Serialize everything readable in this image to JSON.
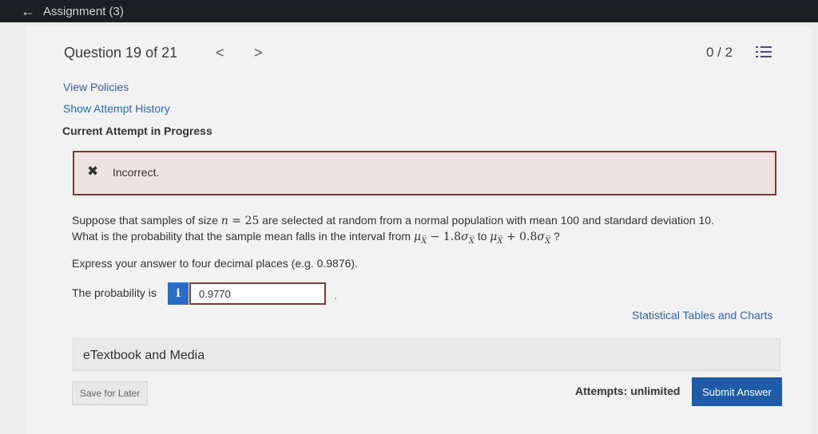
{
  "topbar": {
    "back_icon": "←",
    "title": "Assignment (3)"
  },
  "header": {
    "question_label": "Question 19 of 21",
    "prev_icon": "<",
    "next_icon": ">",
    "score": "0 / 2",
    "list_icon": "list-icon"
  },
  "links": {
    "view_policies": "View Policies",
    "show_attempt_history": "Show Attempt History"
  },
  "status": {
    "current_attempt": "Current Attempt in Progress"
  },
  "feedback": {
    "icon": "✖",
    "message": "Incorrect."
  },
  "question": {
    "line1_a": "Suppose that samples of size ",
    "n_var": "n",
    "eq": " = ",
    "n_val": "25",
    "line1_b": " are selected at random from a normal population with mean 100 and standard deviation 10.",
    "line2_a": "What is the probability that the sample mean falls in the interval from ",
    "mu": "μ",
    "xbar": "X̅",
    "minus_part": " − 1.8",
    "sigma": "σ",
    "to": " to ",
    "plus_part": " + 0.8",
    "qmark": " ?",
    "instructions": "Express your answer to four decimal places (e.g. 0.9876)."
  },
  "answer": {
    "label": "The probability is",
    "info_icon": "i",
    "value": "0.9770",
    "trailing": "."
  },
  "stat_link": "Statistical Tables and Charts",
  "etextbook": "eTextbook and Media",
  "footer": {
    "save_label": "Save for Later",
    "attempts": "Attempts: unlimited",
    "submit_label": "Submit Answer"
  },
  "colors": {
    "topbar": "#1b1e22",
    "link": "#2a65b5",
    "incorrect_border": "#7c3b36",
    "incorrect_bg": "#efe3e1",
    "submit": "#1f5ca8"
  }
}
